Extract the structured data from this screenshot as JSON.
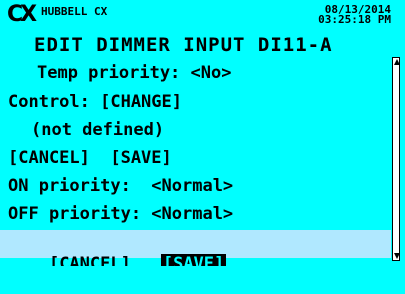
{
  "header": {
    "logo": "CX",
    "brand": "HUBBELL CX",
    "date": "08/13/2014",
    "time": "03:25:18 PM"
  },
  "title": "EDIT DIMMER INPUT DI11-A",
  "rows": {
    "temp_priority": "Temp priority: <No>",
    "control": "Control: [CHANGE]",
    "not_defined": "(not defined)",
    "cancel_save_1": "[CANCEL]  [SAVE]",
    "on_priority": "ON priority:  <Normal>",
    "off_priority": "OFF priority: <Normal>",
    "cancel_2": "[CANCEL]",
    "save_2": "[SAVE]"
  },
  "colors": {
    "background": "#00ffff",
    "selection": "#b0e8ff",
    "text": "#000000"
  }
}
